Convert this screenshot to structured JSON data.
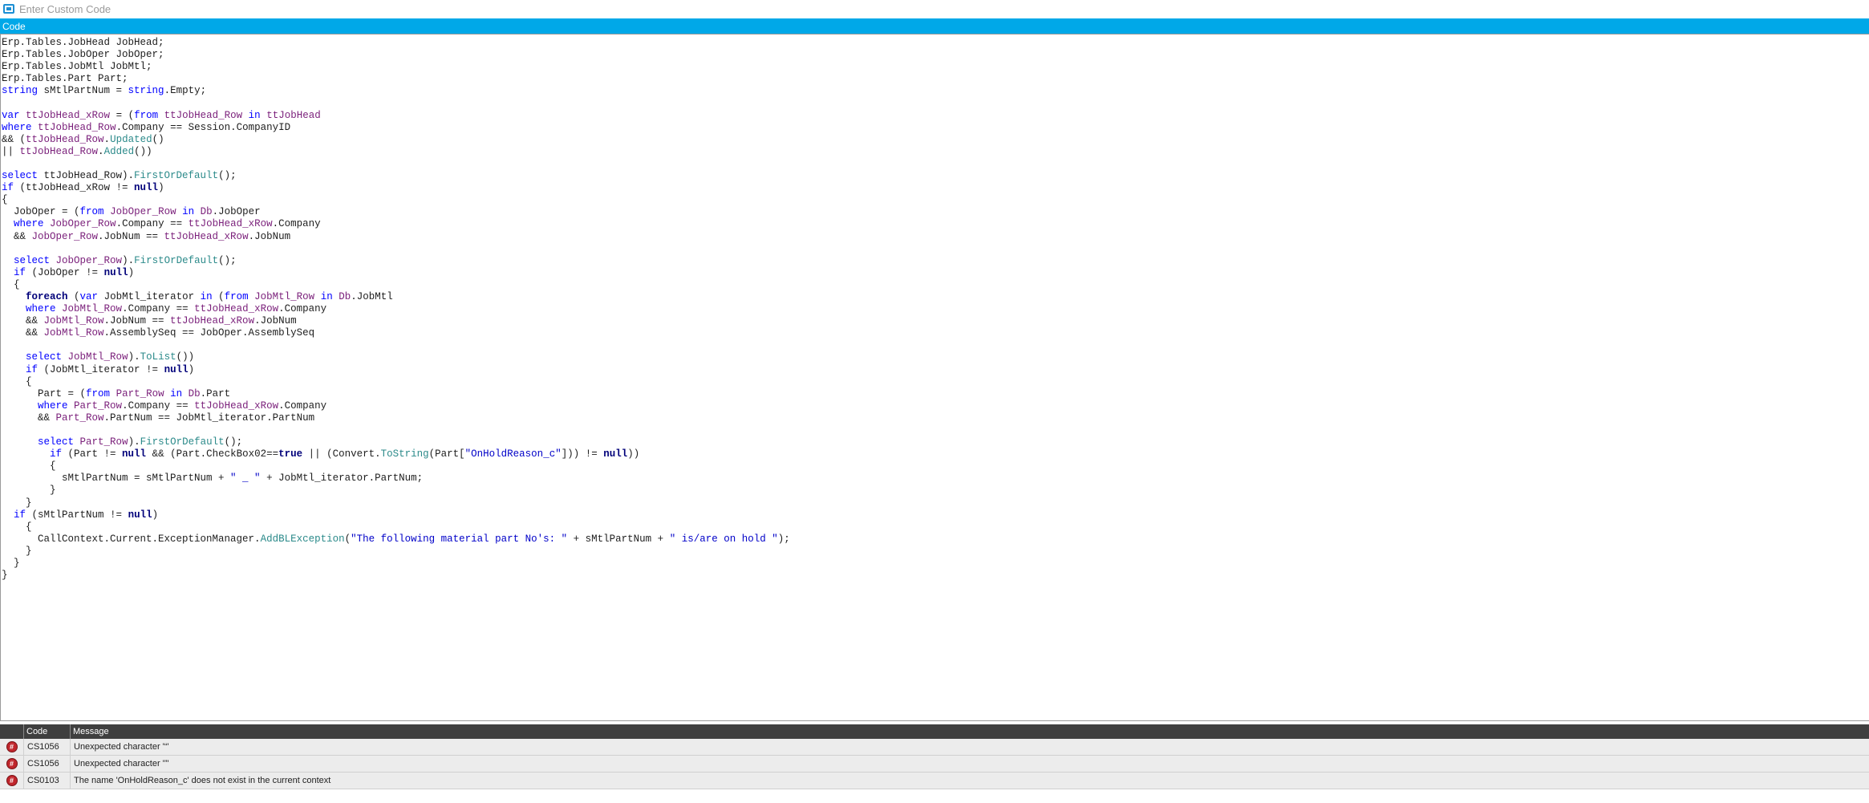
{
  "window": {
    "title": "Enter Custom Code",
    "icon": "code-editor-icon"
  },
  "section": {
    "title": "Code"
  },
  "code_lines": [
    [
      [
        "Erp.Tables.JobHead JobHead;",
        ""
      ]
    ],
    [
      [
        "Erp.Tables.JobOper JobOper;",
        ""
      ]
    ],
    [
      [
        "Erp.Tables.JobMtl JobMtl;",
        ""
      ]
    ],
    [
      [
        "Erp.Tables.Part Part;",
        ""
      ]
    ],
    [
      [
        "string",
        "kw"
      ],
      [
        " sMtlPartNum = ",
        ""
      ],
      [
        "string",
        "kw"
      ],
      [
        ".Empty;",
        ""
      ]
    ],
    [],
    [
      [
        "var",
        "kw"
      ],
      [
        " ",
        ""
      ],
      [
        "ttJobHead_xRow",
        "ty"
      ],
      [
        " = (",
        ""
      ],
      [
        "from",
        "kw"
      ],
      [
        " ",
        ""
      ],
      [
        "ttJobHead_Row",
        "ty"
      ],
      [
        " ",
        ""
      ],
      [
        "in",
        "kw"
      ],
      [
        " ",
        ""
      ],
      [
        "ttJobHead",
        "ty"
      ]
    ],
    [
      [
        "where",
        "kw"
      ],
      [
        " ",
        ""
      ],
      [
        "ttJobHead_Row",
        "ty"
      ],
      [
        ".Company == Session.CompanyID",
        ""
      ]
    ],
    [
      [
        "&& (",
        ""
      ],
      [
        "ttJobHead_Row",
        "ty"
      ],
      [
        ".",
        ""
      ],
      [
        "Updated",
        "fn"
      ],
      [
        "()",
        ""
      ]
    ],
    [
      [
        "|| ",
        ""
      ],
      [
        "ttJobHead_Row",
        "ty"
      ],
      [
        ".",
        ""
      ],
      [
        "Added",
        "fn"
      ],
      [
        "())",
        ""
      ]
    ],
    [],
    [
      [
        "select",
        "kw"
      ],
      [
        " ttJobHead_Row).",
        ""
      ],
      [
        "FirstOrDefault",
        "fn"
      ],
      [
        "();",
        ""
      ]
    ],
    [
      [
        "if",
        "kw"
      ],
      [
        " (ttJobHead_xRow != ",
        ""
      ],
      [
        "null",
        "kwb"
      ],
      [
        ")",
        ""
      ]
    ],
    [
      [
        "{",
        ""
      ]
    ],
    [
      [
        "  JobOper = (",
        ""
      ],
      [
        "from",
        "kw"
      ],
      [
        " ",
        ""
      ],
      [
        "JobOper_Row",
        "ty"
      ],
      [
        " ",
        ""
      ],
      [
        "in",
        "kw"
      ],
      [
        " ",
        ""
      ],
      [
        "Db",
        "ty"
      ],
      [
        ".JobOper",
        ""
      ]
    ],
    [
      [
        "  ",
        ""
      ],
      [
        "where",
        "kw"
      ],
      [
        " ",
        ""
      ],
      [
        "JobOper_Row",
        "ty"
      ],
      [
        ".Company == ",
        ""
      ],
      [
        "ttJobHead_xRow",
        "ty"
      ],
      [
        ".Company",
        ""
      ]
    ],
    [
      [
        "  && ",
        ""
      ],
      [
        "JobOper_Row",
        "ty"
      ],
      [
        ".JobNum == ",
        ""
      ],
      [
        "ttJobHead_xRow",
        "ty"
      ],
      [
        ".JobNum",
        ""
      ]
    ],
    [],
    [
      [
        "  ",
        ""
      ],
      [
        "select",
        "kw"
      ],
      [
        " ",
        ""
      ],
      [
        "JobOper_Row",
        "ty"
      ],
      [
        ").",
        ""
      ],
      [
        "FirstOrDefault",
        "fn"
      ],
      [
        "();",
        ""
      ]
    ],
    [
      [
        "  ",
        ""
      ],
      [
        "if",
        "kw"
      ],
      [
        " (JobOper != ",
        ""
      ],
      [
        "null",
        "kwb"
      ],
      [
        ")",
        ""
      ]
    ],
    [
      [
        "  {",
        ""
      ]
    ],
    [
      [
        "    ",
        ""
      ],
      [
        "foreach",
        "kwb"
      ],
      [
        " (",
        ""
      ],
      [
        "var",
        "kw"
      ],
      [
        " JobMtl_iterator ",
        ""
      ],
      [
        "in",
        "kw"
      ],
      [
        " (",
        ""
      ],
      [
        "from",
        "kw"
      ],
      [
        " ",
        ""
      ],
      [
        "JobMtl_Row",
        "ty"
      ],
      [
        " ",
        ""
      ],
      [
        "in",
        "kw"
      ],
      [
        " ",
        ""
      ],
      [
        "Db",
        "ty"
      ],
      [
        ".JobMtl",
        ""
      ]
    ],
    [
      [
        "    ",
        ""
      ],
      [
        "where",
        "kw"
      ],
      [
        " ",
        ""
      ],
      [
        "JobMtl_Row",
        "ty"
      ],
      [
        ".Company == ",
        ""
      ],
      [
        "ttJobHead_xRow",
        "ty"
      ],
      [
        ".Company",
        ""
      ]
    ],
    [
      [
        "    && ",
        ""
      ],
      [
        "JobMtl_Row",
        "ty"
      ],
      [
        ".JobNum == ",
        ""
      ],
      [
        "ttJobHead_xRow",
        "ty"
      ],
      [
        ".JobNum",
        ""
      ]
    ],
    [
      [
        "    && ",
        ""
      ],
      [
        "JobMtl_Row",
        "ty"
      ],
      [
        ".AssemblySeq == JobOper.AssemblySeq",
        ""
      ]
    ],
    [],
    [
      [
        "    ",
        ""
      ],
      [
        "select",
        "kw"
      ],
      [
        " ",
        ""
      ],
      [
        "JobMtl_Row",
        "ty"
      ],
      [
        ").",
        ""
      ],
      [
        "ToList",
        "fn"
      ],
      [
        "())",
        ""
      ]
    ],
    [
      [
        "    ",
        ""
      ],
      [
        "if",
        "kw"
      ],
      [
        " (JobMtl_iterator != ",
        ""
      ],
      [
        "null",
        "kwb"
      ],
      [
        ")",
        ""
      ]
    ],
    [
      [
        "    {",
        ""
      ]
    ],
    [
      [
        "      Part = (",
        ""
      ],
      [
        "from",
        "kw"
      ],
      [
        " ",
        ""
      ],
      [
        "Part_Row",
        "ty"
      ],
      [
        " ",
        ""
      ],
      [
        "in",
        "kw"
      ],
      [
        " ",
        ""
      ],
      [
        "Db",
        "ty"
      ],
      [
        ".Part",
        ""
      ]
    ],
    [
      [
        "      ",
        ""
      ],
      [
        "where",
        "kw"
      ],
      [
        " ",
        ""
      ],
      [
        "Part_Row",
        "ty"
      ],
      [
        ".Company == ",
        ""
      ],
      [
        "ttJobHead_xRow",
        "ty"
      ],
      [
        ".Company",
        ""
      ]
    ],
    [
      [
        "      && ",
        ""
      ],
      [
        "Part_Row",
        "ty"
      ],
      [
        ".PartNum == JobMtl_iterator.PartNum",
        ""
      ]
    ],
    [],
    [
      [
        "      ",
        ""
      ],
      [
        "select",
        "kw"
      ],
      [
        " ",
        ""
      ],
      [
        "Part_Row",
        "ty"
      ],
      [
        ").",
        ""
      ],
      [
        "FirstOrDefault",
        "fn"
      ],
      [
        "();",
        ""
      ]
    ],
    [
      [
        "        ",
        ""
      ],
      [
        "if",
        "kw"
      ],
      [
        " (Part != ",
        ""
      ],
      [
        "null",
        "kwb"
      ],
      [
        " && (Part.CheckBox02==",
        ""
      ],
      [
        "true",
        "kwb"
      ],
      [
        " || (Convert.",
        ""
      ],
      [
        "ToString",
        "fn"
      ],
      [
        "(Part[",
        ""
      ],
      [
        "\"OnHoldReason_c\"",
        "str"
      ],
      [
        "])) != ",
        ""
      ],
      [
        "null",
        "kwb"
      ],
      [
        "))",
        ""
      ]
    ],
    [
      [
        "        {",
        ""
      ]
    ],
    [
      [
        "          sMtlPartNum = sMtlPartNum + ",
        ""
      ],
      [
        "\" _ \"",
        "str"
      ],
      [
        " + JobMtl_iterator.PartNum;",
        ""
      ]
    ],
    [
      [
        "        }",
        ""
      ]
    ],
    [
      [
        "    }",
        ""
      ]
    ],
    [
      [
        "  ",
        ""
      ],
      [
        "if",
        "kw"
      ],
      [
        " (sMtlPartNum != ",
        ""
      ],
      [
        "null",
        "kwb"
      ],
      [
        ")",
        ""
      ]
    ],
    [
      [
        "    {",
        ""
      ]
    ],
    [
      [
        "      CallContext.Current.ExceptionManager.",
        ""
      ],
      [
        "AddBLException",
        "fn"
      ],
      [
        "(",
        ""
      ],
      [
        "\"The following material part No's: \"",
        "str"
      ],
      [
        " + sMtlPartNum + ",
        ""
      ],
      [
        "\" is/are on hold \"",
        "str"
      ],
      [
        ");",
        ""
      ]
    ],
    [
      [
        "    }",
        ""
      ]
    ],
    [
      [
        "  }",
        ""
      ]
    ],
    [
      [
        "}",
        ""
      ]
    ]
  ],
  "errors": {
    "headers": {
      "code": "Code",
      "message": "Message"
    },
    "rows": [
      {
        "icon": "error-icon",
        "code": "CS1056",
        "message": "Unexpected character '“'"
      },
      {
        "icon": "error-icon",
        "code": "CS1056",
        "message": "Unexpected character '”'"
      },
      {
        "icon": "error-icon",
        "code": "CS0103",
        "message": "The name 'OnHoldReason_c' does not exist in the current context"
      }
    ]
  },
  "colors": {
    "header_bar": "#00a8e8",
    "keyword": "#0000ff",
    "identifier": "#7a1f7a",
    "method": "#2b8a8a",
    "string": "#0000c8",
    "error_icon": "#c0262c"
  }
}
